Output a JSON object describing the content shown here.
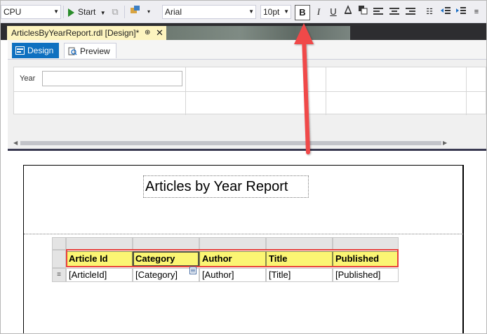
{
  "toolbar": {
    "config_value": "CPU",
    "start_label": "Start",
    "font_name": "Arial",
    "font_size": "10pt",
    "bold_label": "B",
    "italic_label": "I",
    "underline_label": "U"
  },
  "document_tab": {
    "label": "ArticlesByYearReport.rdl [Design]*",
    "pin_glyph": "⊕",
    "close_glyph": "✕"
  },
  "view_tabs": [
    {
      "label": "Design",
      "icon": "design-icon"
    },
    {
      "label": "Preview",
      "icon": "preview-icon"
    }
  ],
  "parameters": [
    {
      "label": "Year",
      "value": ""
    }
  ],
  "report": {
    "title": "Articles by Year Report",
    "columns": [
      "Article Id",
      "Category",
      "Author",
      "Title",
      "Published"
    ],
    "fields": [
      "[ArticleId]",
      "[Category]",
      "[Author]",
      "[Title]",
      "[Published]"
    ]
  },
  "colors": {
    "accent": "#0e70c0",
    "header_fill": "#fbf573",
    "highlight": "#e8403c"
  }
}
